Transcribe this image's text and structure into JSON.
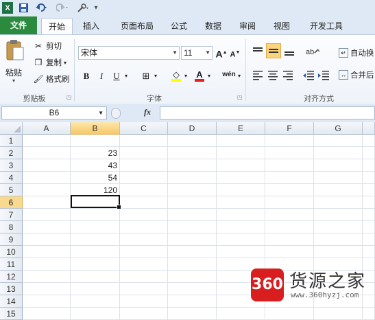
{
  "quick_access": {
    "excel_icon": "X",
    "save_icon": "save-icon",
    "undo_icon": "undo-icon",
    "redo_icon": "redo-icon",
    "customize_icon": "customize-icon"
  },
  "tabs": [
    {
      "label": "文件"
    },
    {
      "label": "开始"
    },
    {
      "label": "插入"
    },
    {
      "label": "页面布局"
    },
    {
      "label": "公式"
    },
    {
      "label": "数据"
    },
    {
      "label": "审阅"
    },
    {
      "label": "视图"
    },
    {
      "label": "开发工具"
    }
  ],
  "ribbon": {
    "clipboard": {
      "paste": "粘贴",
      "cut": "剪切",
      "copy": "复制",
      "format_painter": "格式刷",
      "group_label": "剪贴板"
    },
    "font": {
      "font_name": "宋体",
      "font_size": "11",
      "grow": "A",
      "shrink": "A",
      "bold": "B",
      "italic": "I",
      "underline": "U",
      "border": "⊞",
      "fill": "◇",
      "font_color": "A",
      "phonetic": "wén",
      "group_label": "字体"
    },
    "alignment": {
      "wrap_text": "自动换",
      "merge_center": "合并后",
      "group_label": "对齐方式"
    }
  },
  "formula_bar": {
    "name_box": "B6",
    "fx": "fx",
    "formula": ""
  },
  "sheet": {
    "columns": [
      "A",
      "B",
      "C",
      "D",
      "E",
      "F",
      "G"
    ],
    "rows": [
      "1",
      "2",
      "3",
      "4",
      "5",
      "6",
      "7",
      "8",
      "9",
      "10",
      "11",
      "12",
      "13",
      "14",
      "15"
    ],
    "selected_col": "B",
    "selected_row": "6",
    "values": {
      "B2": "23",
      "B3": "43",
      "B4": "54",
      "B5": "120"
    }
  },
  "watermark": {
    "logo": "360",
    "name": "货源之家",
    "url": "www.360hyzj.com"
  },
  "colors": {
    "file_tab": "#2a8a3e",
    "selection_header": "#f6c86a",
    "watermark_red": "#d81e1e"
  }
}
